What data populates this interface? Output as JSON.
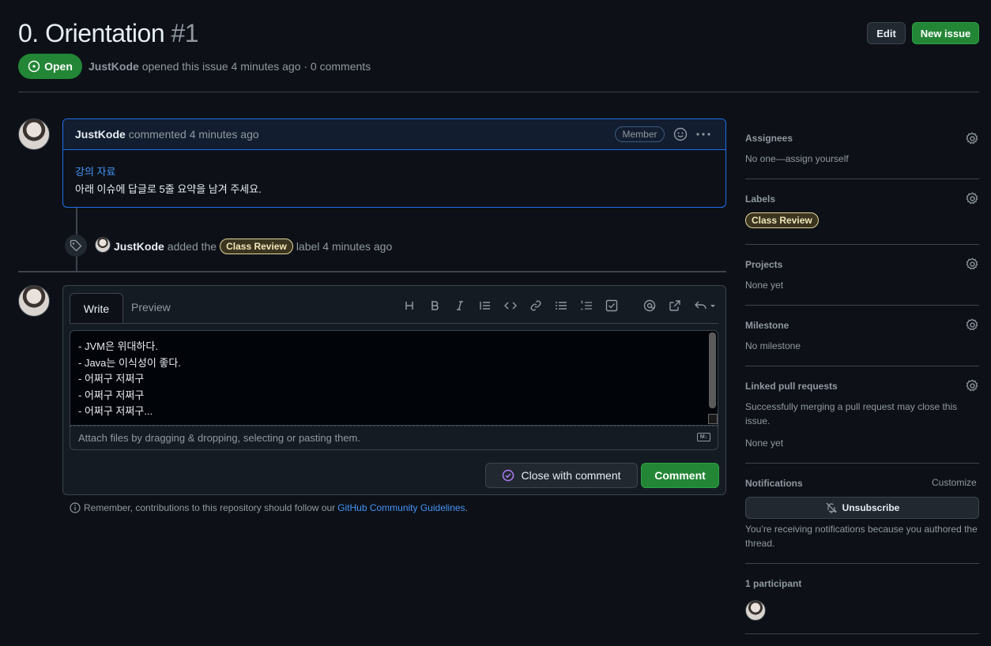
{
  "issue": {
    "title": "0. Orientation",
    "number": "#1",
    "state": "Open",
    "author": "JustKode",
    "meta_text": "opened this issue 4 minutes ago · 0 comments"
  },
  "header": {
    "edit_label": "Edit",
    "new_issue_label": "New issue"
  },
  "comment": {
    "author": "JustKode",
    "time_text": "commented 4 minutes ago",
    "badge": "Member",
    "link_text": "강의 자료",
    "body_text": "아래 이슈에 답글로 5줄 요약을 남겨 주세요."
  },
  "event": {
    "actor": "JustKode",
    "pre_text": "added the",
    "label": "Class Review",
    "post_text": "label 4 minutes ago"
  },
  "editor": {
    "tabs": [
      "Write",
      "Preview"
    ],
    "content": "- JVM은 위대하다.\n- Java는 이식성이 좋다.\n- 어쩌구 저쩌구\n- 어쩌구 저쩌구\n- 어쩌구 저쩌구...",
    "attach_text": "Attach files by dragging & dropping, selecting or pasting them.",
    "md_badge": "M↓",
    "close_label": "Close with comment",
    "comment_label": "Comment",
    "remember_text": "Remember, contributions to this repository should follow our",
    "guidelines_link": "GitHub Community Guidelines",
    "remember_end": "."
  },
  "toolbar_icons": [
    "heading-icon",
    "bold-icon",
    "italic-icon",
    "quote-icon",
    "code-icon",
    "link-icon",
    "unordered-list-icon",
    "ordered-list-icon",
    "task-list-icon",
    "mention-icon",
    "reference-icon",
    "reply-icon"
  ],
  "sidebar": {
    "assignees_title": "Assignees",
    "assignees_value": "No one—assign yourself",
    "labels_title": "Labels",
    "label_value": "Class Review",
    "projects_title": "Projects",
    "projects_value": "None yet",
    "milestone_title": "Milestone",
    "milestone_value": "No milestone",
    "linked_title": "Linked pull requests",
    "linked_desc": "Successfully merging a pull request may close this issue.",
    "linked_value": "None yet",
    "notifications_title": "Notifications",
    "customize": "Customize",
    "unsubscribe": "Unsubscribe",
    "notif_desc": "You’re receiving notifications because you authored the thread.",
    "participants": "1 participant"
  },
  "colors": {
    "accent_green": "#238636",
    "link_blue": "#4493f8",
    "bg": "#0d1117",
    "label_yellow": "#e3d59b"
  }
}
